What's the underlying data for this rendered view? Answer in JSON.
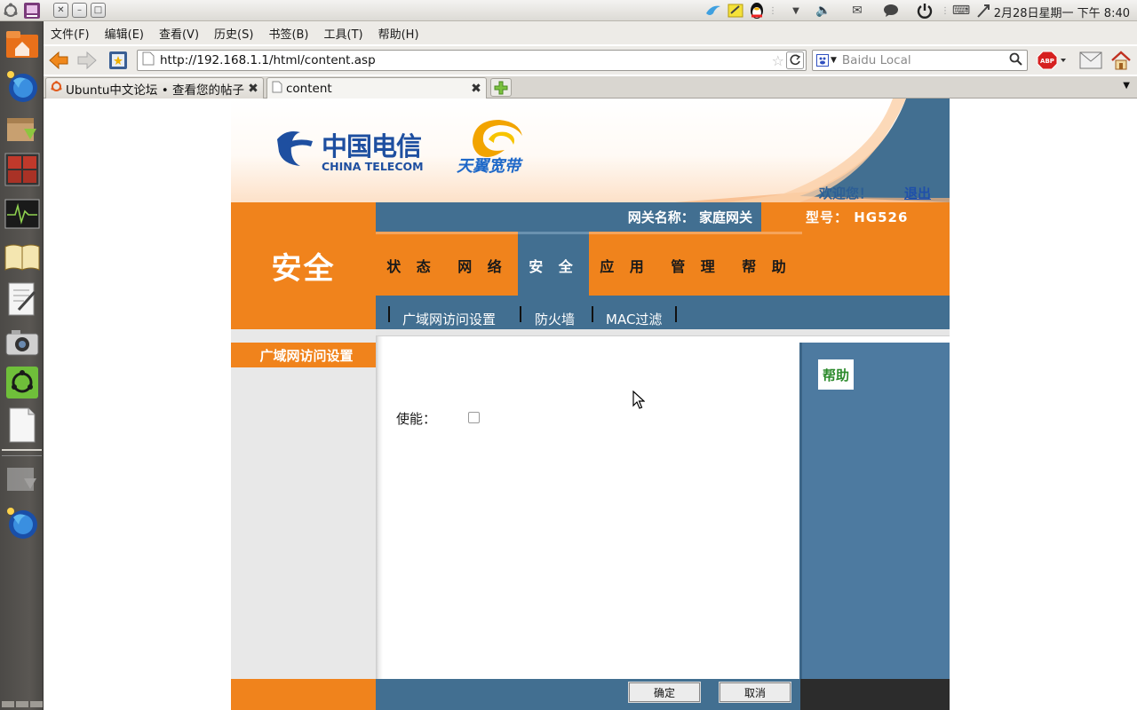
{
  "system_panel": {
    "clock": "2月28日星期一 下午  8:40"
  },
  "browser": {
    "menu": [
      "文件(F)",
      "编辑(E)",
      "查看(V)",
      "历史(S)",
      "书签(B)",
      "工具(T)",
      "帮助(H)"
    ],
    "url": "http://192.168.1.1/html/content.asp",
    "search_placeholder": "Baidu Local",
    "tabs": [
      {
        "label": "Ubuntu中文论坛 • 查看您的帖子"
      },
      {
        "label": "content"
      }
    ]
  },
  "router": {
    "welcome": "欢迎您！",
    "logout": "退出",
    "section_title": "安全",
    "gateway_name": "网关名称：  家庭网关",
    "model": "型号：  HG526",
    "nav_tabs": [
      "状 态",
      "网 络",
      "安 全",
      "应 用",
      "管 理",
      "帮 助"
    ],
    "active_nav_index": 2,
    "subnav": [
      "广域网访问设置",
      "防火墙",
      "MAC过滤"
    ],
    "left_menu_active": "广域网访问设置",
    "enable_label": "使能：",
    "enable_checked": false,
    "help_label": "帮助",
    "confirm_button": "确定",
    "cancel_button": "取消"
  },
  "colors": {
    "orange": "#f0831c",
    "blue": "#426f91",
    "help_blue": "#4d7aa0"
  }
}
